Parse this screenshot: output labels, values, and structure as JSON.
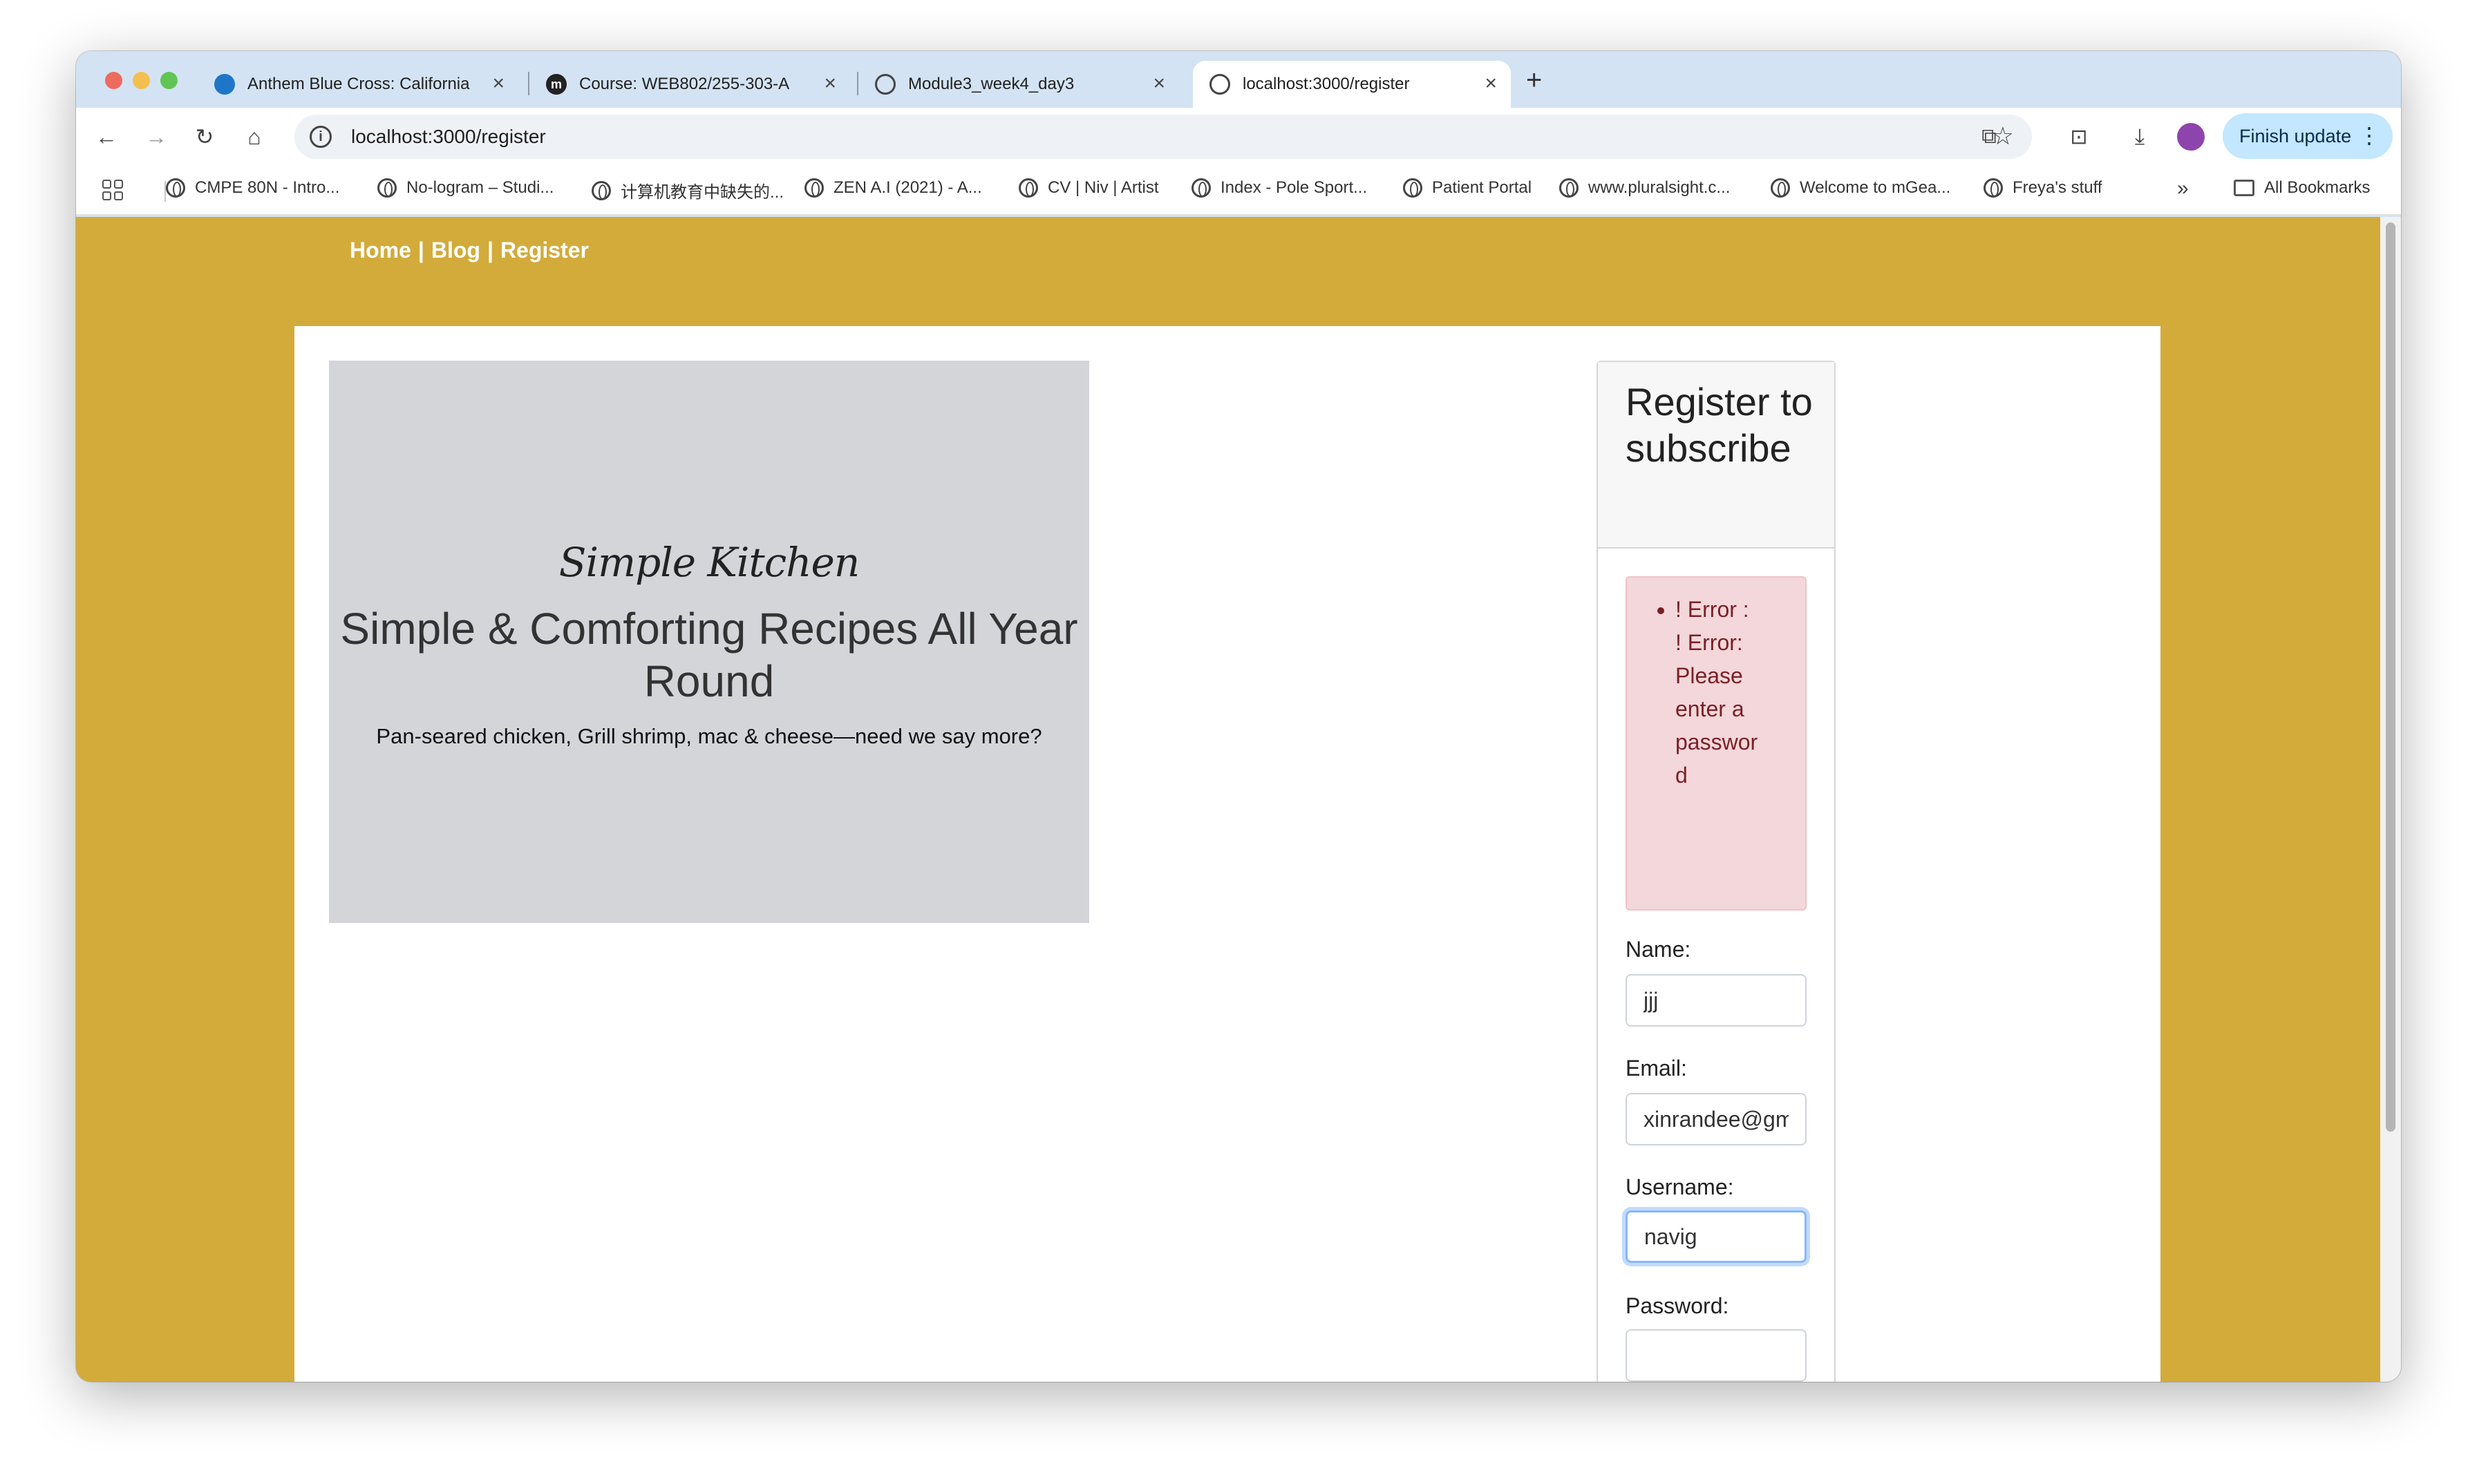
{
  "browser": {
    "tabs": [
      {
        "title": "Anthem Blue Cross: California",
        "favicon": "anthem-icon",
        "active": false
      },
      {
        "title": "Course: WEB802/255-303-A",
        "favicon": "moodle-icon",
        "active": false
      },
      {
        "title": "Module3_week4_day3",
        "favicon": "globe-icon",
        "active": false
      },
      {
        "title": "localhost:3000/register",
        "favicon": "globe-icon",
        "active": true
      }
    ],
    "new_tab": "+",
    "url": "localhost:3000/register",
    "update_button": "Finish update",
    "bookmarks": [
      "CMPE 80N - Intro...",
      "No-logram – Studi...",
      "计算机教育中缺失的...",
      "ZEN A.I (2021) - A...",
      "CV | Niv | Artist",
      "Index - Pole Sport...",
      "Patient Portal",
      "www.pluralsight.c...",
      "Welcome to mGea...",
      "Freya's stuff"
    ],
    "more_bookmarks": "»",
    "all_bookmarks": "All Bookmarks"
  },
  "site": {
    "nav": {
      "home": "Home",
      "blog": "Blog",
      "register": "Register",
      "separator": "|"
    },
    "hero": {
      "logo": "Simple Kitchen",
      "title": "Simple & Comforting Recipes All Year Round",
      "subtitle": "Pan-seared chicken, Grill shrimp, mac & cheese—need we say more?"
    },
    "register": {
      "heading": "Register to subscribe",
      "error": "! Error : ! Error: Please enter a password",
      "name_label": "Name:",
      "name_value": "jjj",
      "email_label": "Email:",
      "email_value": "xinrandee@gm",
      "username_label": "Username:",
      "username_value": "navig",
      "password_label": "Password:",
      "password_value": ""
    }
  },
  "colors": {
    "page_background": "#d3ab3a",
    "hero_background": "#d4d5d9",
    "error_background": "#f3d7da",
    "error_text": "#7a1f26",
    "tabstrip": "#d3e3f3"
  }
}
